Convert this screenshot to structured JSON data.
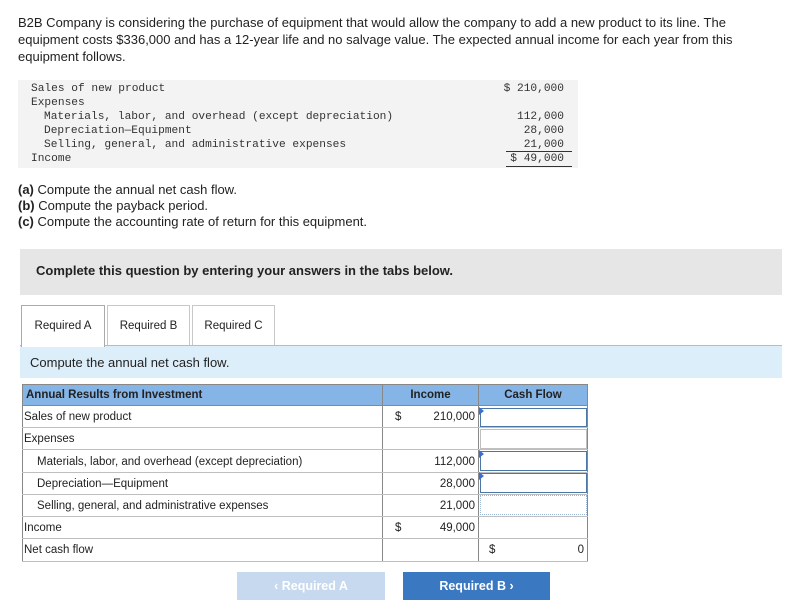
{
  "intro": "B2B Company is considering the purchase of equipment that would allow the company to add a new product to its line. The equipment costs $336,000 and has a 12-year life and no salvage value. The expected annual income for each year from this equipment follows.",
  "statement": {
    "sales_label": "Sales of new product",
    "sales_amount": "$ 210,000",
    "expenses_label": "Expenses",
    "materials_label": "Materials, labor, and overhead (except depreciation)",
    "materials_amount": "112,000",
    "depreciation_label": "Depreciation—Equipment",
    "depreciation_amount": "28,000",
    "selling_label": "Selling, general, and administrative expenses",
    "selling_amount": "21,000",
    "income_label": "Income",
    "income_amount": "$ 49,000"
  },
  "parts": {
    "a_tag": "(a)",
    "a_text": " Compute the annual net cash flow.",
    "b_tag": "(b)",
    "b_text": " Compute the payback period.",
    "c_tag": "(c)",
    "c_text": " Compute the accounting rate of return for this equipment."
  },
  "banner": "Complete this question by entering your answers in the tabs below.",
  "tabs": [
    "Required A",
    "Required B",
    "Required C"
  ],
  "instruction": "Compute the annual net cash flow.",
  "table": {
    "headers": {
      "label": "Annual Results from Investment",
      "income": "Income",
      "cashflow": "Cash Flow"
    },
    "rows": {
      "sales": {
        "label": "Sales of new product",
        "dollar": "$",
        "income": "210,000"
      },
      "expenses": {
        "label": "Expenses"
      },
      "materials": {
        "label": "Materials, labor, and overhead (except depreciation)",
        "income": "112,000"
      },
      "depreciation": {
        "label": "Depreciation—Equipment",
        "income": "28,000"
      },
      "selling": {
        "label": "Selling, general, and administrative expenses",
        "income": "21,000"
      },
      "income": {
        "label": "Income",
        "dollar": "$",
        "income": "49,000"
      },
      "netcash": {
        "label": "Net cash flow",
        "dollar": "$",
        "cashflow": "0"
      }
    }
  },
  "nav": {
    "prev": "Required A",
    "next": "Required B"
  },
  "colors": {
    "header_blue": "#85b4e6",
    "instruction_bg": "#dceefa",
    "next_button": "#3a78c2",
    "prev_button": "#c6d9ef"
  }
}
